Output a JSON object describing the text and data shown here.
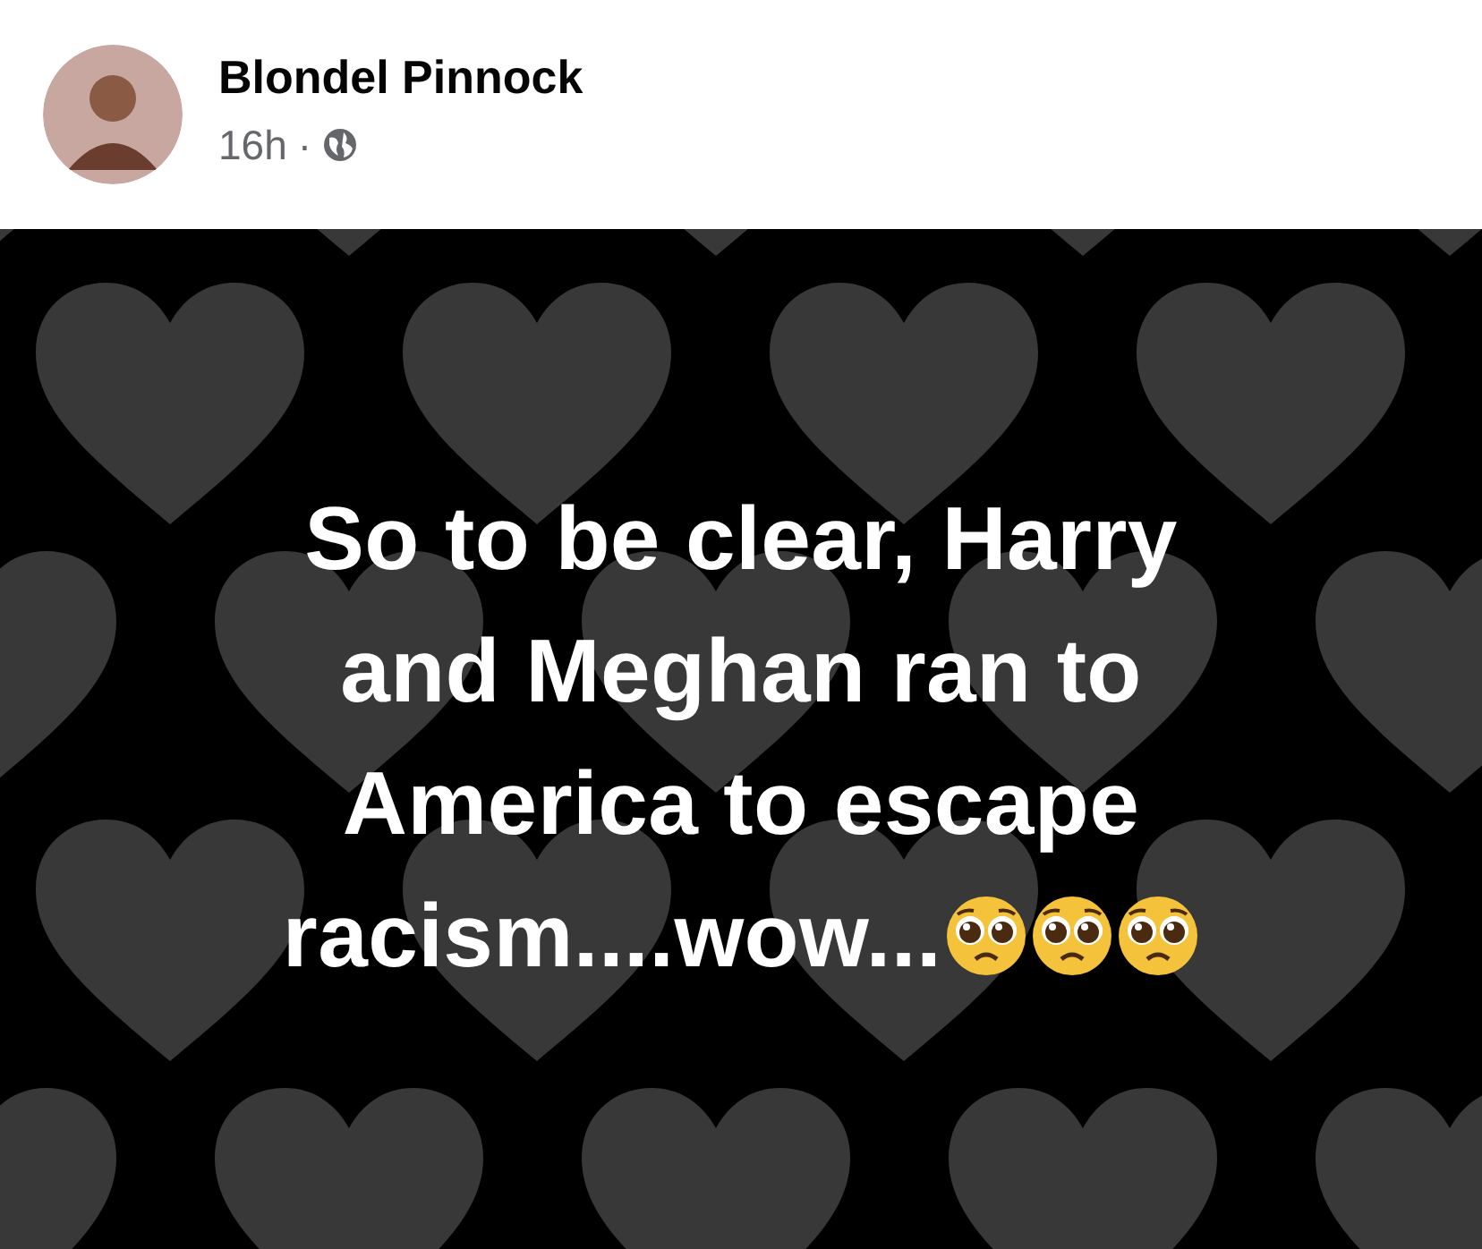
{
  "post": {
    "author": "Blondel Pinnock",
    "time": "16h",
    "separator": "·",
    "audience_icon": {
      "kind": "globe"
    }
  },
  "text_post": {
    "lines": [
      "So to be clear, Harry",
      "and Meghan ran to",
      "America to escape",
      "racism....wow..."
    ],
    "emojis": [
      {
        "kind": "pleading_face"
      },
      {
        "kind": "pleading_face"
      },
      {
        "kind": "pleading_face"
      }
    ]
  }
}
